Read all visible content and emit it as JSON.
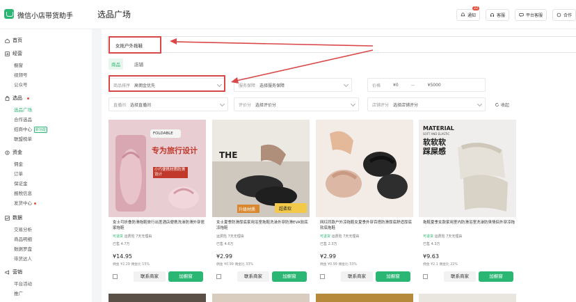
{
  "app": {
    "title": "微信小店带货助手"
  },
  "header": {
    "page_title": "选品广场",
    "nav": [
      {
        "label": "通知",
        "badge": "22",
        "icon": "bell-icon"
      },
      {
        "label": "客服",
        "icon": "headset-icon"
      },
      {
        "label": "平台客服",
        "icon": "chat-icon"
      },
      {
        "label": "合作",
        "icon": "handshake-icon"
      }
    ]
  },
  "sidebar": {
    "groups": [
      {
        "label": "首页",
        "icon": "home-icon",
        "items": []
      },
      {
        "label": "经营",
        "icon": "chart-icon",
        "items": [
          "橱窗",
          "视频号",
          "公众号"
        ]
      },
      {
        "label": "选品",
        "icon": "bag-icon",
        "dot": true,
        "items": [
          "选品广场",
          "合作选品",
          "招商中心",
          "联盟榜单"
        ],
        "active_item": "选品广场",
        "new_item": "招商中心",
        "new_label": "新功能"
      },
      {
        "label": "资金",
        "icon": "wallet-icon",
        "items": [
          "佣金",
          "订单",
          "保证金",
          "报税信息",
          "发货中心"
        ],
        "dot_item": "发货中心"
      },
      {
        "label": "数据",
        "icon": "data-icon",
        "items": [
          "交易分析",
          "商品明细",
          "数据罗盘",
          "带货达人"
        ]
      },
      {
        "label": "营销",
        "icon": "megaphone-icon",
        "items": [
          "平台活动",
          "推广"
        ]
      }
    ]
  },
  "search": {
    "value": "女拖户外拖鞋"
  },
  "tabs": [
    {
      "label": "商品",
      "active": true
    },
    {
      "label": "店铺",
      "active": false
    }
  ],
  "filters": {
    "sort": {
      "label": "商品排序",
      "value": "高佣金优先"
    },
    "service": {
      "label": "服务保障",
      "value": "选择服务保障"
    },
    "price": {
      "label": "价格",
      "min": "¥0",
      "max": "¥5000"
    },
    "platform": {
      "label": "直播间",
      "value": "选择直播间"
    },
    "rating": {
      "label": "评价分",
      "value": "选择评价分"
    },
    "store_rating": {
      "label": "店铺评分",
      "value": "选择店铺评分"
    },
    "collapse": "收起"
  },
  "products": [
    {
      "image_label": "专为旅行设计",
      "image_sub": "小巧便携材质防滑设计",
      "image_tag": "FOLDABLE",
      "title": "女士可折叠防滑拖鞋旅行出差酒店便携洗澡防滑外穿居家拖鞋",
      "meta_a": "可退货",
      "meta_b": "运费险",
      "meta_c": "7天无理由",
      "sold": "已售 4.7万",
      "price": "¥14.95",
      "commission": "佣金 ¥2.29 佣金比 15%",
      "contact_label": "联系商家",
      "add_label": "加橱窗"
    },
    {
      "image_label": "THE",
      "image_sub": "升级材质",
      "image_tag": "超柔软",
      "title": "女士夏季防滑厚底家用浴室拖鞋洗澡外穿防滑EVA软底凉拖鞋",
      "meta_a": "运费险",
      "meta_b": "7天无理由",
      "meta_c": "",
      "sold": "已售 4.6万",
      "price": "¥2.99",
      "commission": "佣金 ¥0.99 佣金比 33%",
      "contact_label": "联系商家",
      "add_label": "加橱窗"
    },
    {
      "image_label": "",
      "image_sub": "",
      "image_tag": "",
      "title": "网红同款户外凉拖鞋女夏季外穿百搭防滑厚底舒适厚底软底拖鞋",
      "meta_a": "可退货",
      "meta_b": "运费险",
      "meta_c": "7天无理由",
      "sold": "已售 2.3万",
      "price": "¥2.99",
      "commission": "佣金 ¥0.99 佣金比 33%",
      "contact_label": "联系商家",
      "add_label": "加橱窗"
    },
    {
      "image_label": "软软软 踩屎感",
      "image_sub": "MATERIAL",
      "image_tag": "SOFT AND ELASTIC",
      "title": "拖鞋夏季女款家用室内防滑浴室洗澡防臭情侣外穿凉拖",
      "meta_a": "可退货",
      "meta_b": "运费险",
      "meta_c": "7天无理由",
      "sold": "已售 4.3万",
      "price": "¥9.63",
      "commission": "佣金 ¥2.1 佣金比 22%",
      "contact_label": "联系商家",
      "add_label": "加橱窗"
    }
  ]
}
